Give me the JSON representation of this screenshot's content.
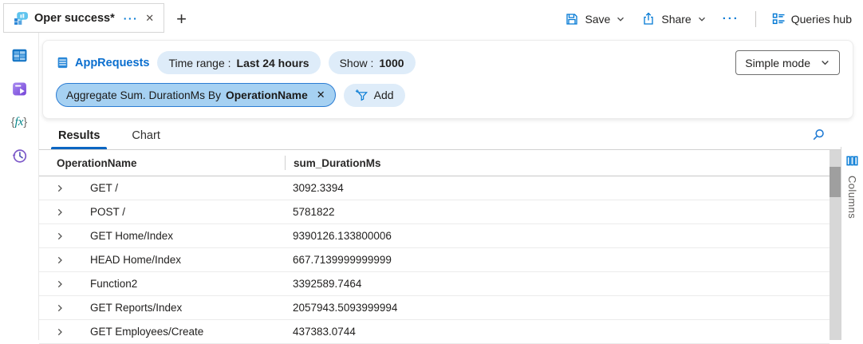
{
  "colors": {
    "accent": "#0078d4",
    "pill_background": "#deecf9",
    "selected_pill_background": "#a6d1f2",
    "selected_pill_border": "#2b7cd3",
    "active_tab_underline": "#0c66c2"
  },
  "tab_bar": {
    "tab": {
      "title": "Oper success*",
      "more_glyph": "···",
      "close_glyph": "✕"
    },
    "new_tab_glyph": "+",
    "actions": {
      "save_label": "Save",
      "share_label": "Share",
      "more_glyph": "···",
      "queries_hub_label": "Queries hub"
    }
  },
  "sidebar": {
    "fx": {
      "open": "{",
      "fx": "fx",
      "close": "}"
    },
    "items": [
      {
        "name": "tables",
        "icon": "table-icon"
      },
      {
        "name": "queries",
        "icon": "queries-icon"
      },
      {
        "name": "functions",
        "icon": "fx-icon"
      },
      {
        "name": "history",
        "icon": "history-icon"
      }
    ]
  },
  "query_builder": {
    "table_name": "AppRequests",
    "time_range_label": "Time range :",
    "time_range_value": "Last 24 hours",
    "show_label": "Show :",
    "show_value": "1000",
    "mode_selector_label": "Simple mode",
    "filter_pill": {
      "text": "Aggregate Sum. DurationMs By",
      "bold": "OperationName",
      "close_glyph": "✕"
    },
    "add_label": "Add"
  },
  "results": {
    "tabs": [
      {
        "label": "Results",
        "active": true
      },
      {
        "label": "Chart",
        "active": false
      }
    ],
    "columns_panel_label": "Columns",
    "table": {
      "headers": [
        "OperationName",
        "sum_DurationMs"
      ],
      "rows": [
        {
          "operation": "GET /",
          "value": "3092.3394"
        },
        {
          "operation": "POST /",
          "value": "5781822"
        },
        {
          "operation": "GET Home/Index",
          "value": "9390126.133800006"
        },
        {
          "operation": "HEAD Home/Index",
          "value": "667.7139999999999"
        },
        {
          "operation": "Function2",
          "value": "3392589.7464"
        },
        {
          "operation": "GET Reports/Index",
          "value": "2057943.5093999994"
        },
        {
          "operation": "GET Employees/Create",
          "value": "437383.0744"
        }
      ]
    }
  }
}
